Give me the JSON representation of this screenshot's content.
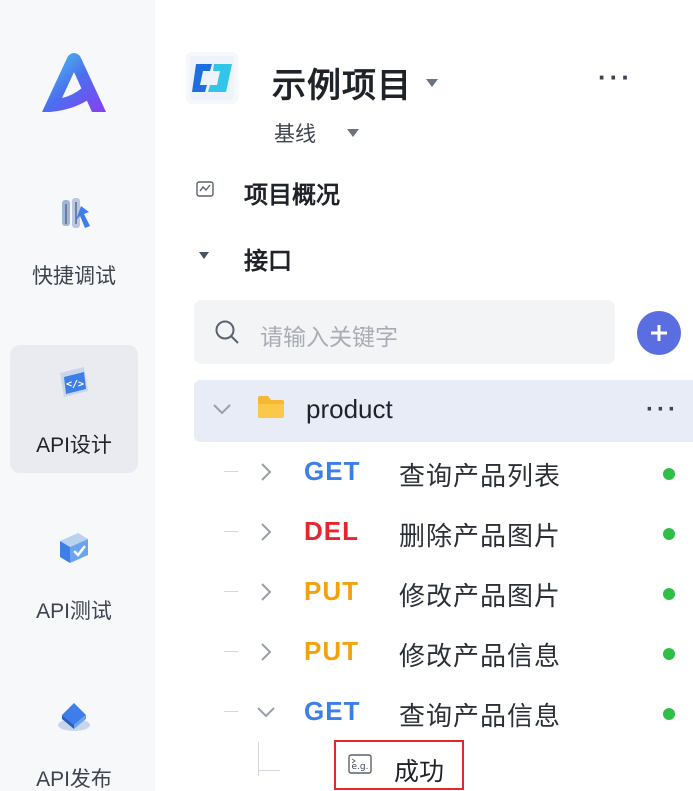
{
  "colors": {
    "get": "#3e7ee8",
    "del": "#e5262e",
    "put": "#f4a20c",
    "status_ok": "#2fbf48",
    "highlight_border": "#e5262e"
  },
  "rail": {
    "items": [
      {
        "label": "快捷调试",
        "icon": "bug-debug-icon"
      },
      {
        "label": "API设计",
        "icon": "code-design-icon",
        "active": true
      },
      {
        "label": "API测试",
        "icon": "test-check-icon"
      },
      {
        "label": "API发布",
        "icon": "publish-icon"
      }
    ]
  },
  "project": {
    "name": "示例项目",
    "branch": "基线",
    "more": "···"
  },
  "nav": {
    "overview": "项目概况",
    "interfaces": "接口"
  },
  "search": {
    "placeholder": "请输入关键字"
  },
  "tree": {
    "folder": {
      "label": "product",
      "more": "···",
      "expanded": true
    },
    "apis": [
      {
        "method": "GET",
        "name": "查询产品列表",
        "expanded": false,
        "status": "ok"
      },
      {
        "method": "DEL",
        "name": "删除产品图片",
        "expanded": false,
        "status": "ok"
      },
      {
        "method": "PUT",
        "name": "修改产品图片",
        "expanded": false,
        "status": "ok"
      },
      {
        "method": "PUT",
        "name": "修改产品信息",
        "expanded": false,
        "status": "ok"
      },
      {
        "method": "GET",
        "name": "查询产品信息",
        "expanded": true,
        "status": "ok"
      }
    ],
    "example": {
      "icon": "example-eg-icon",
      "label": "成功"
    }
  }
}
